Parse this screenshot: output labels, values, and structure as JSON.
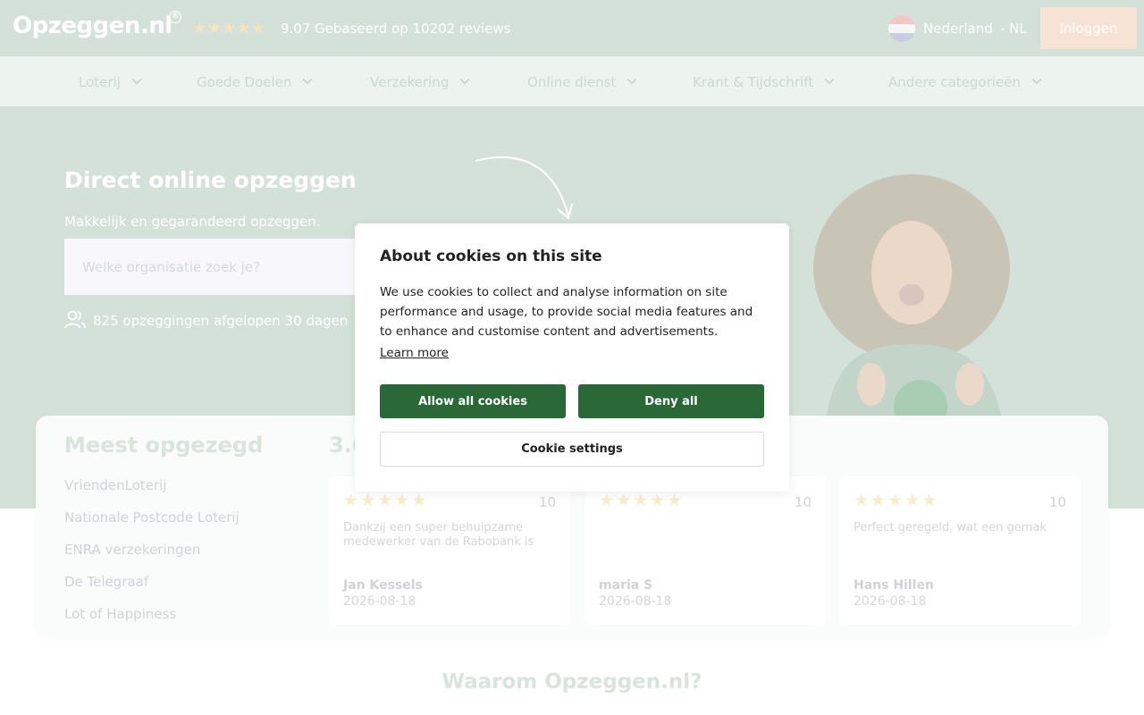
{
  "header": {
    "logo": "Opzeggen.nl",
    "logo_mark": "®",
    "stars": "★★★★★",
    "rating": "9.07",
    "reviews_text": "Gebaseerd op 10202 reviews",
    "country": "Nederland",
    "country_code": "- NL",
    "login_label": "Inloggen"
  },
  "nav": {
    "items": [
      {
        "label": "Loterij"
      },
      {
        "label": "Goede Doelen"
      },
      {
        "label": "Verzekering"
      },
      {
        "label": "Online dienst"
      },
      {
        "label": "Krant & Tijdschrift"
      },
      {
        "label": "Andere categorieën"
      }
    ]
  },
  "hero": {
    "title": "Direct online opzeggen",
    "subtitle": "Makkelijk en gegarandeerd opzeggen.",
    "search_placeholder": "Welke organisatie zoek je?",
    "stat": "825 opzeggingen afgelopen 30 dagen"
  },
  "most_cancelled": {
    "title": "Meest opgezegd",
    "items": [
      "VriendenLoterij",
      "Nationale Postcode Loterij",
      "ENRA verzekeringen",
      "De Telegraaf",
      "Lot of Happiness"
    ]
  },
  "reviews": {
    "count_title": "3.6",
    "items": [
      {
        "stars": "★★★★★",
        "score": "10",
        "text": "Dankzij een super behulpzame medewerker van de Rabobank is het...",
        "author": "Jan Kessels",
        "date": "2026-08-18"
      },
      {
        "stars": "★★★★★",
        "score": "10",
        "text": "",
        "author": "maria S",
        "date": "2026-08-18"
      },
      {
        "stars": "★★★★★",
        "score": "10",
        "text": "Perfect geregeld, wat een gemak",
        "author": "Hans Hillen",
        "date": "2026-08-18"
      }
    ]
  },
  "why_title": "Waarom Opzeggen.nl?",
  "cookie_modal": {
    "title": "About cookies on this site",
    "text": "We use cookies to collect and analyse information on site performance and usage, to provide social media features and to enhance and customise content and advertisements.",
    "learn_more": "Learn more",
    "allow_label": "Allow all cookies",
    "deny_label": "Deny all",
    "settings_label": "Cookie settings"
  },
  "colors": {
    "brand_green": "#2b6837",
    "header_bg": "#d3e1d8",
    "nav_bg": "#edf3ef",
    "login_bg": "#f6e3d5"
  }
}
